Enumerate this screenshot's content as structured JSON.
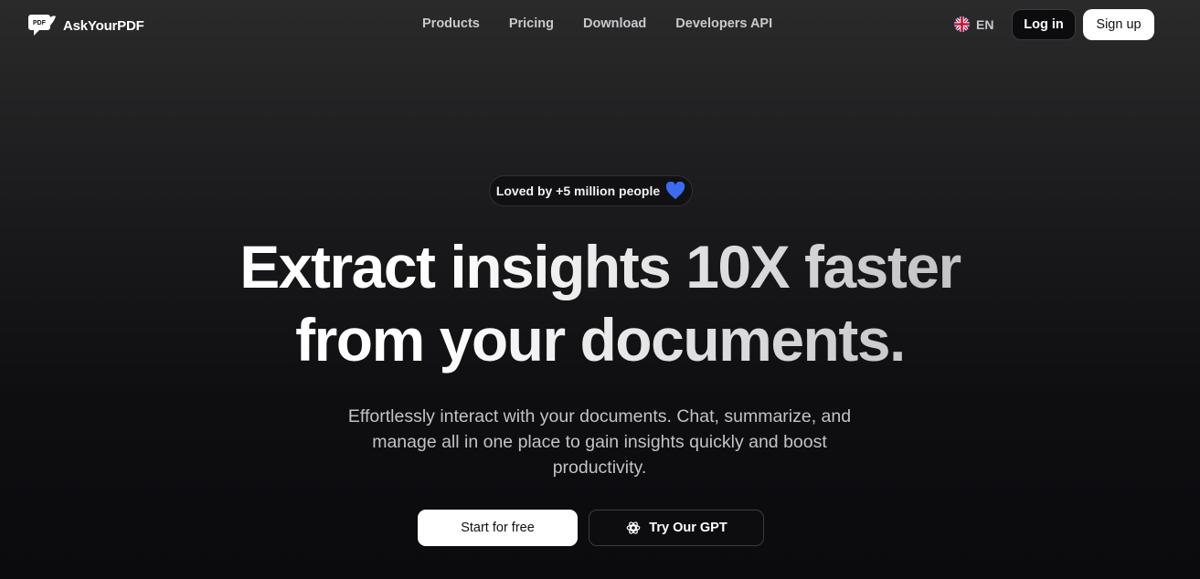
{
  "brand": {
    "name": "AskYourPDF",
    "logo_text": "PDF",
    "icon": "pdf-chat-logo-icon"
  },
  "nav": {
    "links": [
      {
        "label": "Products"
      },
      {
        "label": "Pricing"
      },
      {
        "label": "Download"
      },
      {
        "label": "Developers API"
      }
    ],
    "language": {
      "label": "EN",
      "icon": "uk-flag-icon"
    },
    "login_label": "Log in",
    "signup_label": "Sign up"
  },
  "hero": {
    "badge": {
      "text": "Loved by +5 million people",
      "icon": "blue-heart-icon",
      "icon_color": "#3b6cf0"
    },
    "headline_line1": "Extract insights 10X faster",
    "headline_line2": "from your documents.",
    "subtext": "Effortlessly interact with your documents. Chat, summarize, and manage all in one place to gain insights quickly and boost productivity.",
    "cta_primary": "Start for free",
    "cta_secondary": "Try Our GPT",
    "cta_secondary_icon": "openai-logo-icon"
  },
  "colors": {
    "background_top": "#2a2a2b",
    "background_bottom": "#0b0b0e",
    "accent_heart": "#3b6cf0"
  }
}
